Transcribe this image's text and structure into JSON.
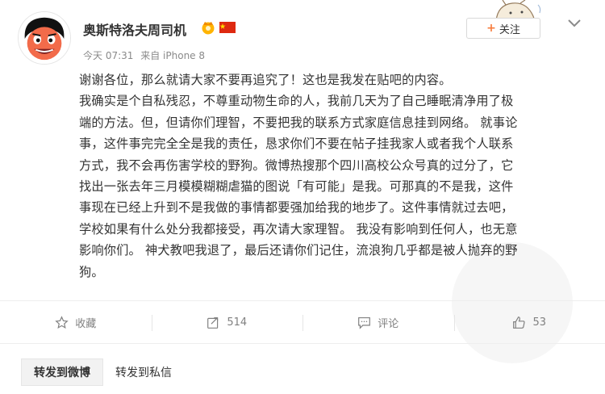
{
  "header": {
    "username": "奥斯特洛夫周司机",
    "time": "今天 07:31",
    "source": "来自 iPhone 8",
    "follow_label": "关注"
  },
  "content_lines": [
    "谢谢各位，那么就请大家不要再追究了！这也是我发在贴吧的内容。",
    "我确实是个自私残忍，不尊重动物生命的人，我前几天为了自己睡眠清净用了极",
    "端的方法。但，但请你们理智，不要把我的联系方式家庭信息挂到网络。 就事论",
    "事，这件事完完全全是我的责任，恳求你们不要在帖子挂我家人或者我个人联系",
    "方式，我不会再伤害学校的野狗。微博热搜那个四川高校公众号真的过分了，它",
    "找出一张去年三月模模糊糊虐猫的图说「有可能」是我。可那真的不是我，这件",
    "事现在已经上升到不是我做的事情都要强加给我的地步了。这件事情就过去吧，",
    "学校如果有什么处分我都接受，再次请大家理智。 我没有影响到任何人，也无意",
    "影响你们。 神犬教吧我退了，最后还请你们记住，流浪狗几乎都是被人抛弃的野",
    "狗。"
  ],
  "actions": {
    "favorite_label": "收藏",
    "repost_count": "514",
    "comment_label": "评论",
    "like_count": "53"
  },
  "share_tabs": {
    "weibo": "转发到微博",
    "private": "转发到私信"
  },
  "colors": {
    "accent": "#f77c3d",
    "flag": "#de2910",
    "muted": "#808080"
  },
  "icons": [
    "avatar-cartoon",
    "vip-icon",
    "china-flag-icon",
    "chevron-down-icon",
    "star-icon",
    "repost-icon",
    "comment-icon",
    "thumbs-up-icon"
  ]
}
